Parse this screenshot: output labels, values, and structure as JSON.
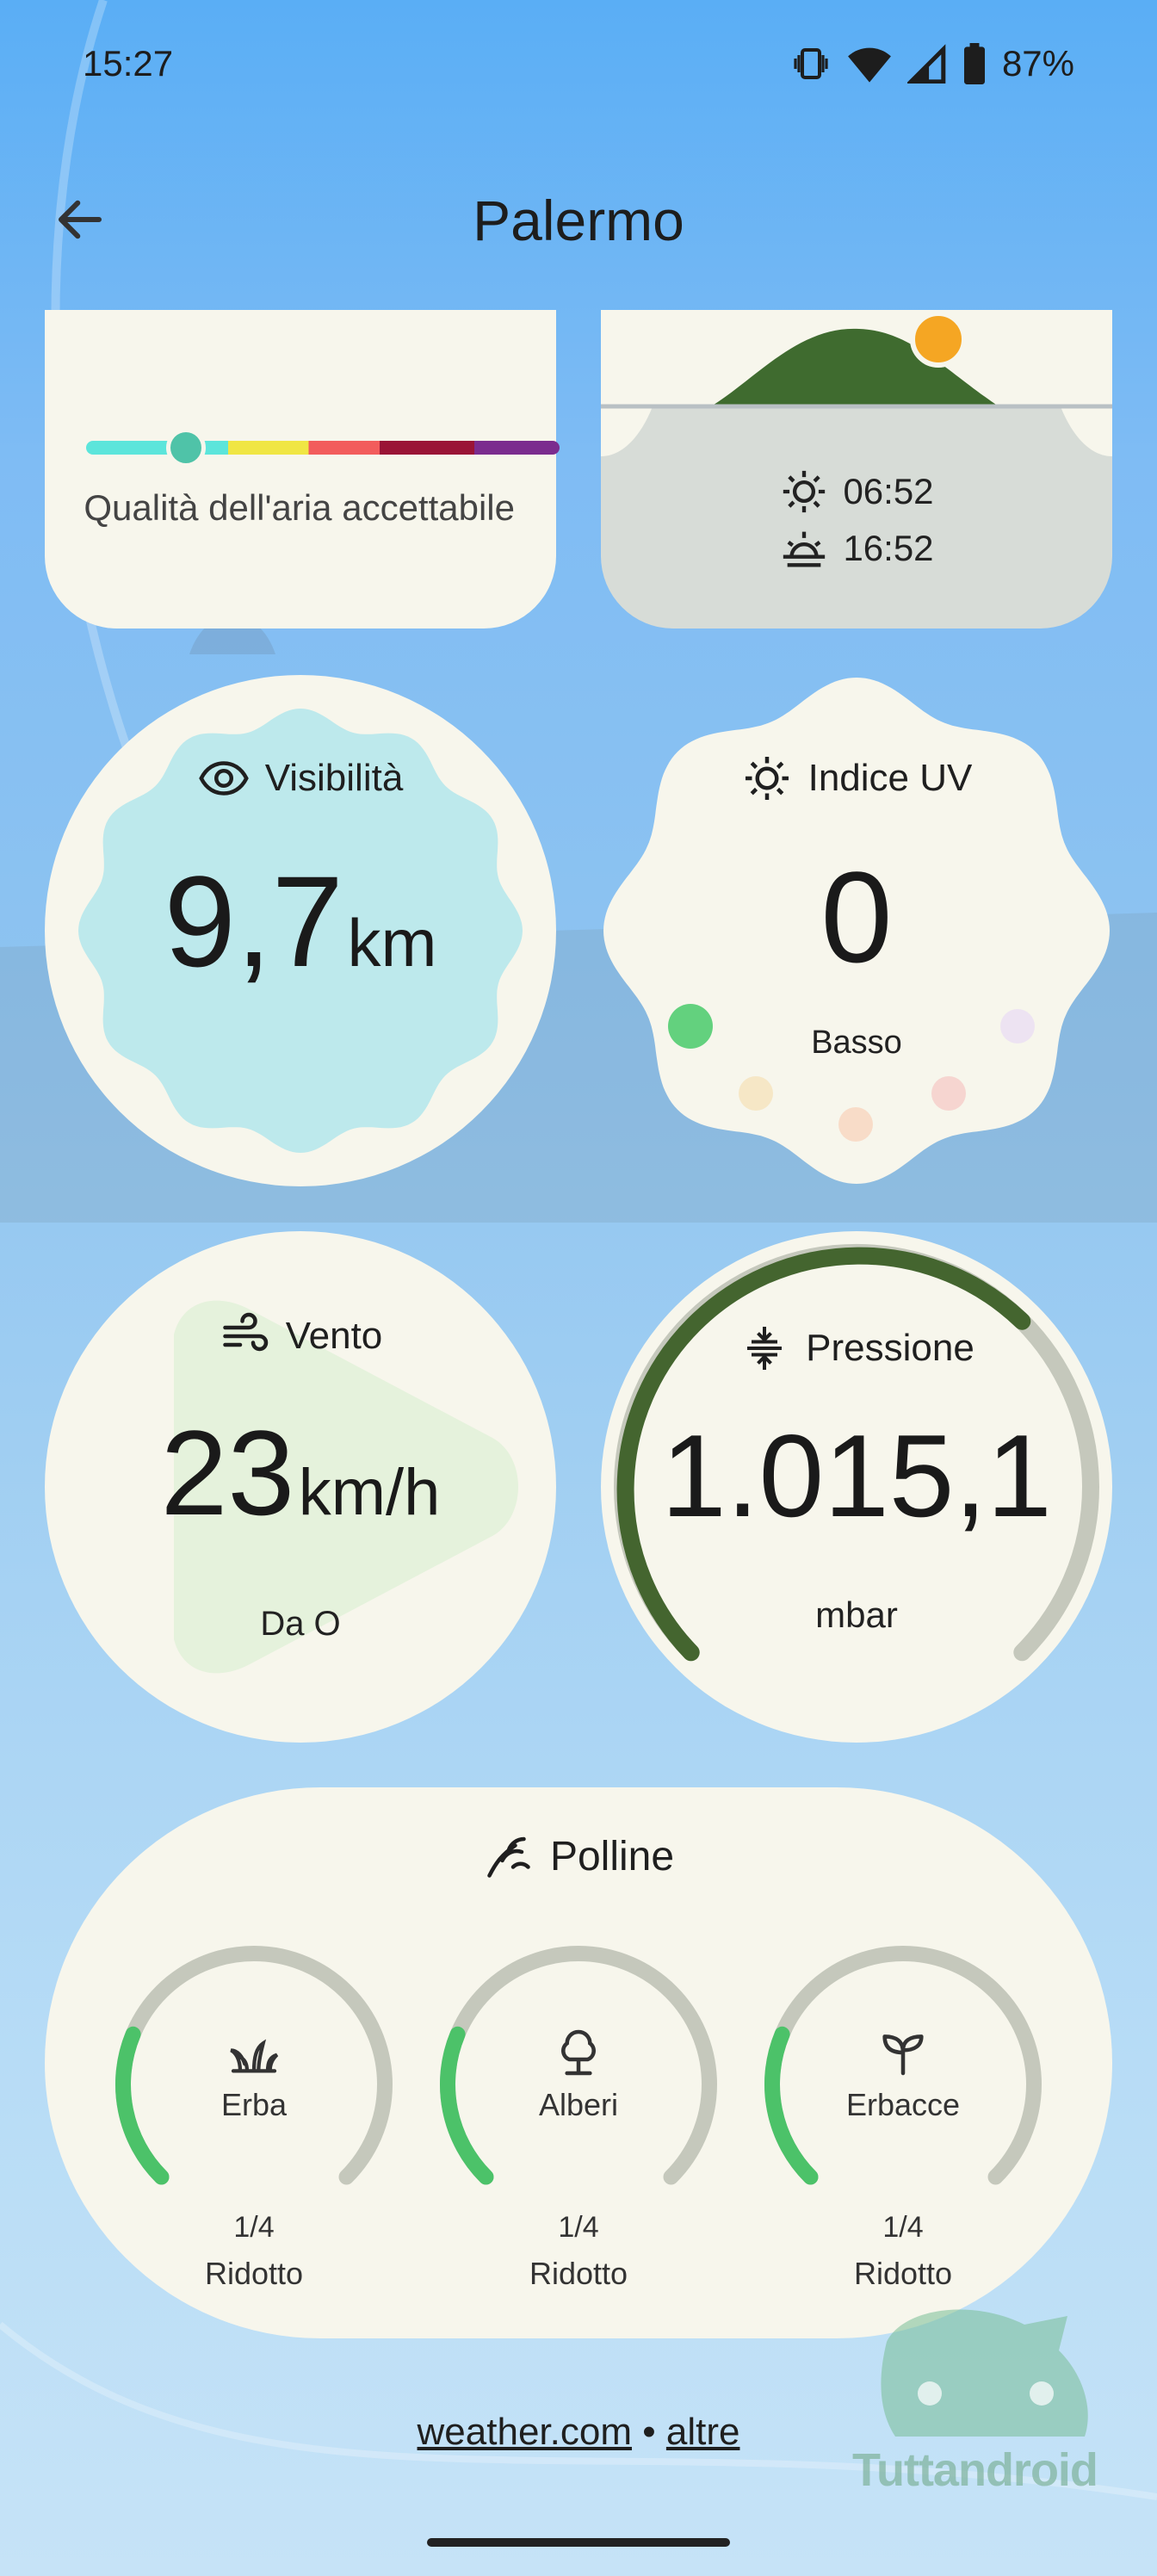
{
  "status_bar": {
    "time": "15:27",
    "battery": "87%",
    "icons": [
      "vibrate-icon",
      "wifi-icon",
      "signal-icon",
      "battery-icon"
    ]
  },
  "header": {
    "title": "Palermo",
    "back_icon": "arrow-back-icon"
  },
  "air_quality": {
    "label": "Qualità dell'aria accettabile",
    "level": 0.21
  },
  "sun": {
    "sunrise": "06:52",
    "sunset": "16:52",
    "sun_color": "#f5a623",
    "hill_color": "#3f6b2f"
  },
  "visibility": {
    "label": "Visibilità",
    "value": "9,7",
    "unit": "km",
    "icon": "eye-icon",
    "fill_color": "#bde9ec"
  },
  "uv": {
    "label": "Indice UV",
    "value": "0",
    "level_text": "Basso",
    "icon": "sun-icon"
  },
  "wind": {
    "label": "Vento",
    "value": "23",
    "unit": "km/h",
    "direction": "Da O",
    "icon": "wind-icon"
  },
  "pressure": {
    "label": "Pressione",
    "value": "1.015,1",
    "unit": "mbar",
    "icon": "compress-icon",
    "arc_color": "#44652f"
  },
  "pollen": {
    "title": "Polline",
    "icon": "pollen-icon",
    "items": [
      {
        "name": "Erba",
        "level": "1/4",
        "status": "Ridotto",
        "icon": "grass-icon",
        "fraction": 0.25
      },
      {
        "name": "Alberi",
        "level": "1/4",
        "status": "Ridotto",
        "icon": "tree-icon",
        "fraction": 0.25
      },
      {
        "name": "Erbacce",
        "level": "1/4",
        "status": "Ridotto",
        "icon": "sprout-icon",
        "fraction": 0.25
      }
    ]
  },
  "footer": {
    "source": "weather.com",
    "separator": "•",
    "others": "altre"
  },
  "watermark": "Tuttandroid"
}
